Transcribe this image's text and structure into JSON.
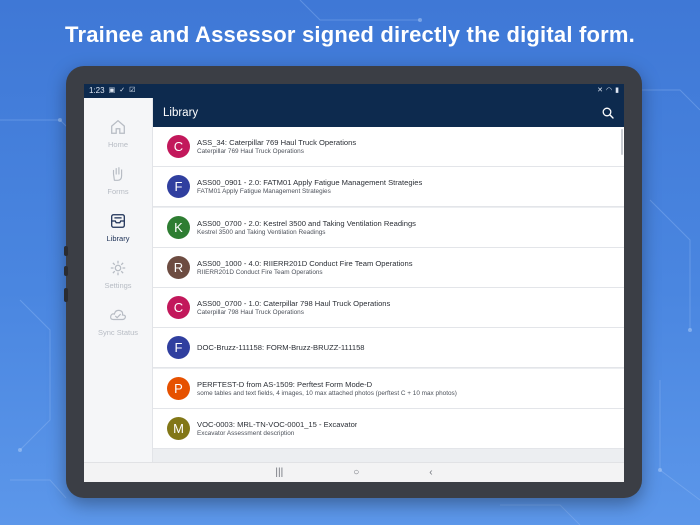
{
  "headline": "Trainee and Assessor signed directly the digital form.",
  "status_bar": {
    "time": "1:23",
    "icons_left": [
      "image-icon",
      "check-icon",
      "box-check-icon"
    ],
    "icons_right": [
      "mute-icon",
      "wifi-icon",
      "battery-icon"
    ]
  },
  "app_bar": {
    "title": "Library",
    "search_icon": "search-icon"
  },
  "sidebar": {
    "items": [
      {
        "label": "Home",
        "icon": "home-icon",
        "active": false
      },
      {
        "label": "Forms",
        "icon": "hand-icon",
        "active": false
      },
      {
        "label": "Library",
        "icon": "library-icon",
        "active": true
      },
      {
        "label": "Settings",
        "icon": "gear-icon",
        "active": false
      },
      {
        "label": "Sync Status",
        "icon": "cloud-icon",
        "active": false
      }
    ]
  },
  "library": {
    "items": [
      {
        "letter": "C",
        "color": "#c2185b",
        "title": "ASS_34: Caterpillar 769 Haul Truck Operations",
        "subtitle": "Caterpillar 769 Haul Truck Operations"
      },
      {
        "letter": "F",
        "color": "#303f9f",
        "title": "ASS00_0901 - 2.0: FATM01 Apply Fatigue Management Strategies",
        "subtitle": "FATM01 Apply Fatigue Management Strategies"
      },
      {
        "letter": "K",
        "color": "#2e7d32",
        "title": "ASS00_0700 - 2.0: Kestrel 3500 and Taking Ventilation Readings",
        "subtitle": "Kestrel 3500 and Taking Ventilation Readings"
      },
      {
        "letter": "R",
        "color": "#6d4c41",
        "title": "ASS00_1000 - 4.0: RIIERR201D Conduct Fire Team Operations",
        "subtitle": "RIIERR201D Conduct Fire Team Operations"
      },
      {
        "letter": "C",
        "color": "#c2185b",
        "title": "ASS00_0700 - 1.0: Caterpillar 798 Haul Truck Operations",
        "subtitle": "Caterpillar 798 Haul Truck Operations"
      },
      {
        "letter": "F",
        "color": "#303f9f",
        "title": "DOC-Bruzz-111158: FORM-Bruzz-BRUZZ-111158",
        "subtitle": ""
      },
      {
        "letter": "P",
        "color": "#e65100",
        "title": "PERFTEST-D from AS-1509: Perftest Form Mode-D",
        "subtitle": "some tables and text fields, 4 images, 10 max attached photos (perftest C + 10 max photos)"
      },
      {
        "letter": "M",
        "color": "#827717",
        "title": "VOC-0003: MRL-TN-VOC-0001_15 - Excavator",
        "subtitle": "Excavator Assessment description"
      }
    ]
  },
  "nav_bar": {
    "icons": [
      "recents-icon",
      "home-circle-icon",
      "back-icon"
    ]
  }
}
